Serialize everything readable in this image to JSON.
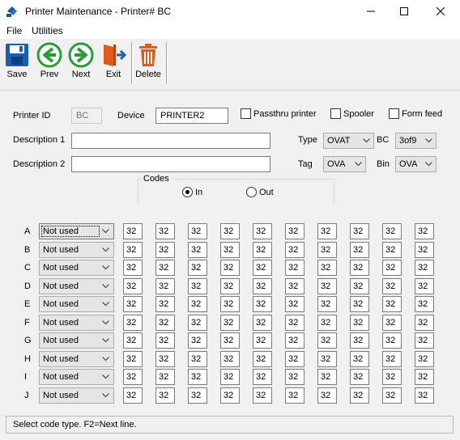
{
  "window": {
    "title": "Printer Maintenance - Printer# BC",
    "icon": "printer-app-icon",
    "controls": {
      "minimize": "—",
      "maximize": "☐",
      "close": "✕"
    }
  },
  "menu": [
    "File",
    "Utilities"
  ],
  "toolbar": {
    "save": "Save",
    "prev": "Prev",
    "next": "Next",
    "exit": "Exit",
    "delete": "Delete"
  },
  "form": {
    "printer_id_label": "Printer ID",
    "printer_id_value": "BC",
    "device_label": "Device",
    "device_value": "PRINTER2",
    "passthru_label": "Passthru printer",
    "spooler_label": "Spooler",
    "formfeed_label": "Form feed",
    "desc1_label": "Description 1",
    "desc1_value": "",
    "desc2_label": "Description 2",
    "desc2_value": "",
    "type_label": "Type",
    "type_value": "OVAT",
    "bc_label": "BC",
    "bc_value": "3of9",
    "tag_label": "Tag",
    "tag_value": "OVA",
    "bin_label": "Bin",
    "bin_value": "OVA"
  },
  "codes": {
    "title": "Codes",
    "in_label": "In",
    "out_label": "Out",
    "selected": "In"
  },
  "grid": {
    "rows": [
      {
        "letter": "A",
        "type": "Not used",
        "cells": [
          "32",
          "32",
          "32",
          "32",
          "32",
          "32",
          "32",
          "32",
          "32",
          "32"
        ]
      },
      {
        "letter": "B",
        "type": "Not used",
        "cells": [
          "32",
          "32",
          "32",
          "32",
          "32",
          "32",
          "32",
          "32",
          "32",
          "32"
        ]
      },
      {
        "letter": "C",
        "type": "Not used",
        "cells": [
          "32",
          "32",
          "32",
          "32",
          "32",
          "32",
          "32",
          "32",
          "32",
          "32"
        ]
      },
      {
        "letter": "D",
        "type": "Not used",
        "cells": [
          "32",
          "32",
          "32",
          "32",
          "32",
          "32",
          "32",
          "32",
          "32",
          "32"
        ]
      },
      {
        "letter": "E",
        "type": "Not used",
        "cells": [
          "32",
          "32",
          "32",
          "32",
          "32",
          "32",
          "32",
          "32",
          "32",
          "32"
        ]
      },
      {
        "letter": "F",
        "type": "Not used",
        "cells": [
          "32",
          "32",
          "32",
          "32",
          "32",
          "32",
          "32",
          "32",
          "32",
          "32"
        ]
      },
      {
        "letter": "G",
        "type": "Not used",
        "cells": [
          "32",
          "32",
          "32",
          "32",
          "32",
          "32",
          "32",
          "32",
          "32",
          "32"
        ]
      },
      {
        "letter": "H",
        "type": "Not used",
        "cells": [
          "32",
          "32",
          "32",
          "32",
          "32",
          "32",
          "32",
          "32",
          "32",
          "32"
        ]
      },
      {
        "letter": "I",
        "type": "Not used",
        "cells": [
          "32",
          "32",
          "32",
          "32",
          "32",
          "32",
          "32",
          "32",
          "32",
          "32"
        ]
      },
      {
        "letter": "J",
        "type": "Not used",
        "cells": [
          "32",
          "32",
          "32",
          "32",
          "32",
          "32",
          "32",
          "32",
          "32",
          "32"
        ]
      }
    ]
  },
  "status": "Select code type. F2=Next line.",
  "colors": {
    "save_blue": "#1a5fb4",
    "nav_green": "#2a9d3a",
    "exit_orange": "#e05a1a",
    "delete_orange": "#e05a1a"
  }
}
